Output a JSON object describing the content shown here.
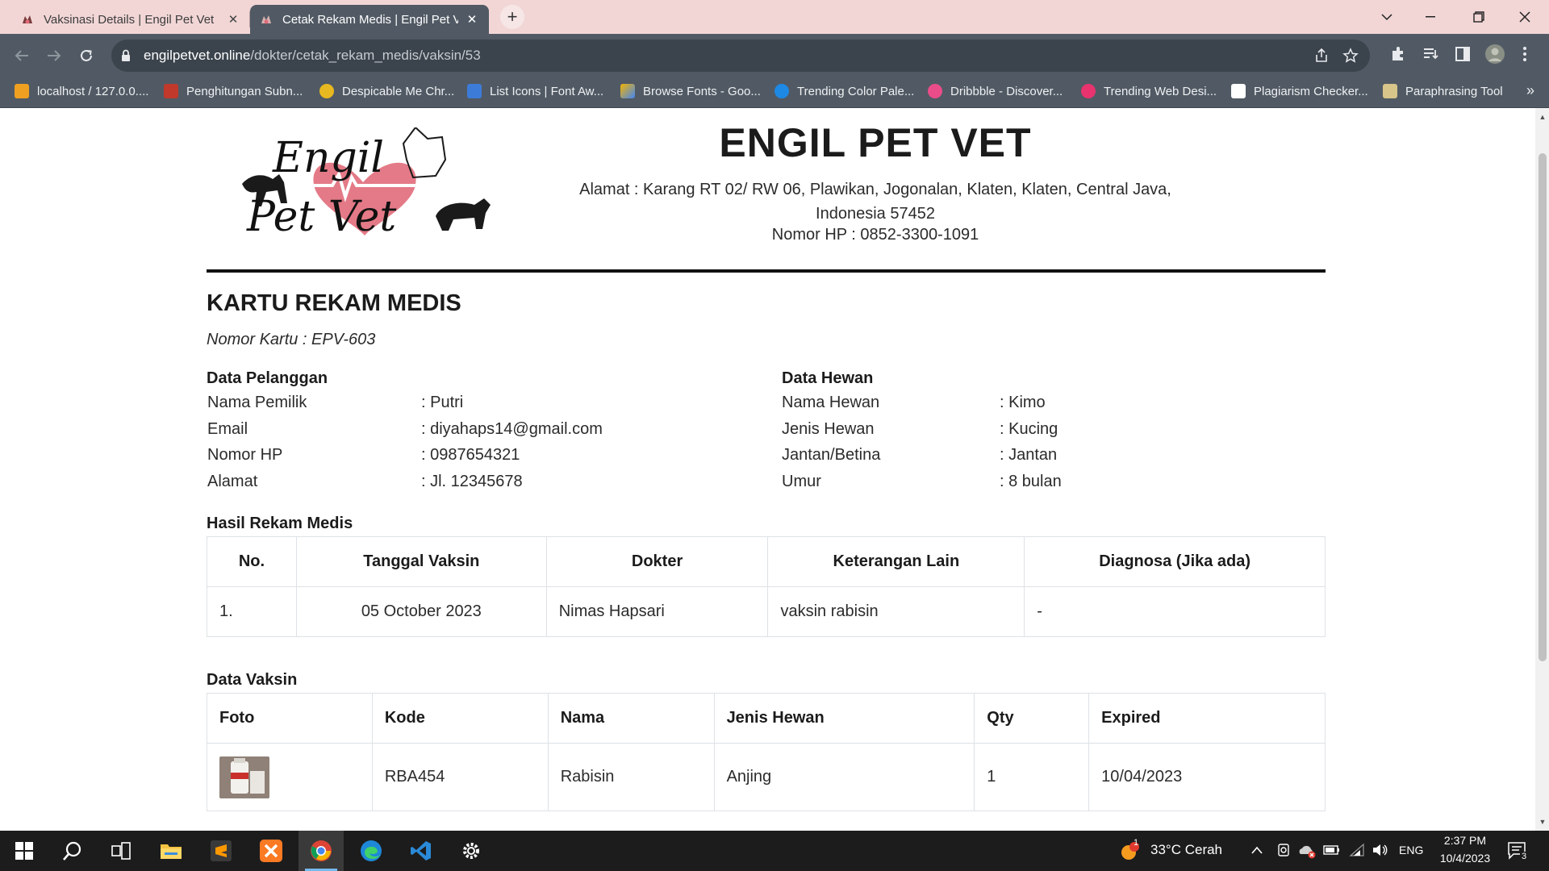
{
  "browser": {
    "tabs": [
      {
        "title": "Vaksinasi Details | Engil Pet Vet",
        "active": false
      },
      {
        "title": "Cetak Rekam Medis | Engil Pet Vet",
        "active": true
      }
    ],
    "url_domain": "engilpetvet.online",
    "url_path": "/dokter/cetak_rekam_medis/vaksin/53",
    "bookmarks": [
      {
        "label": "localhost / 127.0.0....",
        "icon": "phpmyadmin-icon",
        "color": "#f0a020"
      },
      {
        "label": "Penghitungan Subn...",
        "icon": "rsw-icon",
        "color": "#c0392b"
      },
      {
        "label": "Despicable Me Chr...",
        "icon": "minion-icon",
        "color": "#e8b820"
      },
      {
        "label": "List Icons | Font Aw...",
        "icon": "flag-icon",
        "color": "#3d7bd9"
      },
      {
        "label": "Browse Fonts - Goo...",
        "icon": "google-fonts-icon",
        "color": "#f4b400"
      },
      {
        "label": "Trending Color Pale...",
        "icon": "coolors-icon",
        "color": "#1e88e5"
      },
      {
        "label": "Dribbble - Discover...",
        "icon": "dribbble-icon",
        "color": "#ea4c89"
      },
      {
        "label": "Trending Web Desi...",
        "icon": "dribbble-icon",
        "color": "#e8336f"
      },
      {
        "label": "Plagiarism Checker...",
        "icon": "sst-icon",
        "color": "#ffffff"
      },
      {
        "label": "Paraphrasing Tool",
        "icon": "paraphrase-icon",
        "color": "#d8c58a"
      }
    ]
  },
  "page": {
    "logo_text_line1": "Engil",
    "logo_text_line2": "Pet Vet",
    "clinic_name": "ENGIL PET VET",
    "address": "Alamat : Karang RT 02/ RW 06, Plawikan, Jogonalan, Klaten, Klaten, Central Java, Indonesia 57452",
    "phone": "Nomor HP : 0852-3300-1091",
    "card_title": "KARTU REKAM MEDIS",
    "card_number": "Nomor Kartu : EPV-603",
    "pelanggan": {
      "title": "Data Pelanggan",
      "rows": [
        {
          "label": "Nama Pemilik",
          "value": ": Putri"
        },
        {
          "label": "Email",
          "value": ": diyahaps14@gmail.com"
        },
        {
          "label": "Nomor HP",
          "value": ": 0987654321"
        },
        {
          "label": "Alamat",
          "value": ": Jl. 12345678"
        }
      ]
    },
    "hewan": {
      "title": "Data Hewan",
      "rows": [
        {
          "label": "Nama Hewan",
          "value": ": Kimo"
        },
        {
          "label": "Jenis Hewan",
          "value": ": Kucing"
        },
        {
          "label": "Jantan/Betina",
          "value": ": Jantan"
        },
        {
          "label": "Umur",
          "value": ": 8 bulan"
        }
      ]
    },
    "rekam_medis": {
      "title": "Hasil Rekam Medis",
      "headers": [
        "No.",
        "Tanggal Vaksin",
        "Dokter",
        "Keterangan Lain",
        "Diagnosa (Jika ada)"
      ],
      "rows": [
        [
          "1.",
          "05 October 2023",
          "Nimas Hapsari",
          "vaksin rabisin",
          "-"
        ]
      ]
    },
    "vaksin": {
      "title": "Data Vaksin",
      "headers": [
        "Foto",
        "Kode",
        "Nama",
        "Jenis Hewan",
        "Qty",
        "Expired"
      ],
      "rows": [
        [
          "",
          "RBA454",
          "Rabisin",
          "Anjing",
          "1",
          "10/04/2023"
        ]
      ]
    }
  },
  "taskbar": {
    "weather": "33°C  Cerah",
    "language": "ENG",
    "time": "2:37 PM",
    "date": "10/4/2023",
    "notification_count": "3",
    "weather_badge": "1"
  }
}
